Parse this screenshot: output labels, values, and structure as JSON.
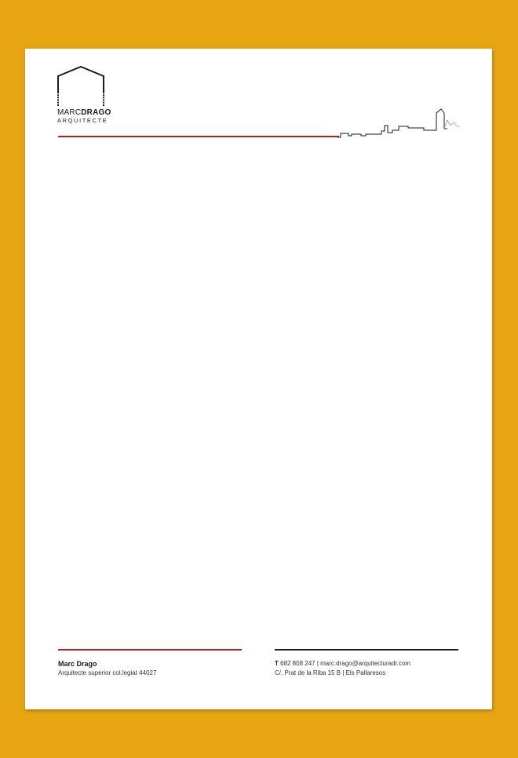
{
  "colors": {
    "background": "#e7a514",
    "paper": "#ffffff",
    "accent_red": "#b51f1f",
    "text_dark": "#1a1a1a"
  },
  "logo": {
    "name_first": "MARC",
    "name_last": "DRAGO",
    "subtitle": "ARQUITECTE",
    "icon": "house-outline-icon"
  },
  "header": {
    "illustration": "city-skyline-icon"
  },
  "footer": {
    "name": "Marc Drago",
    "title": "Arquitecte superior col.legiat 44027",
    "phone_label": "T",
    "phone_and_email": " 682 808 247 | marc.drago@arquitecturadr.com",
    "address": "C/. Prat de la Riba 15 B | Els Pallaresos"
  }
}
